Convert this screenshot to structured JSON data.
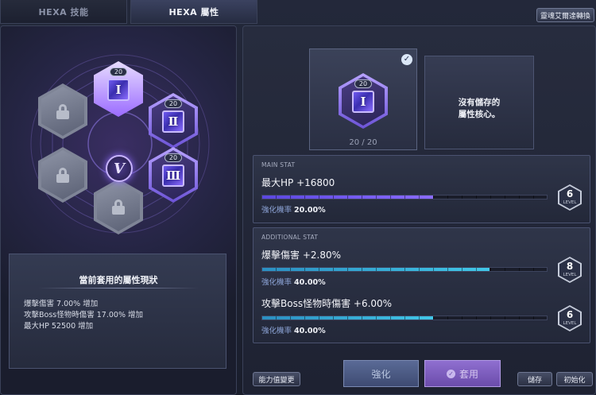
{
  "tabs": [
    {
      "label": "HEXA 技能"
    },
    {
      "label": "HEXA 屬性"
    }
  ],
  "header": {
    "convert_label": "靈魂艾爾達轉換"
  },
  "hexa_grid": {
    "slots": [
      {
        "state": "selected",
        "numeral": "Ⅰ",
        "level": "20"
      },
      {
        "state": "active",
        "numeral": "Ⅱ",
        "level": "20"
      },
      {
        "state": "active",
        "numeral": "Ⅲ",
        "level": "20"
      },
      {
        "state": "locked"
      },
      {
        "state": "locked"
      },
      {
        "state": "locked"
      }
    ],
    "center_emblem": "V"
  },
  "status": {
    "title": "當前套用的屬性現狀",
    "lines": [
      "爆擊傷害 7.00% 增加",
      "攻擊Boss怪物時傷害 17.00% 增加",
      "最大HP 52500 增加"
    ]
  },
  "core_card": {
    "level": "20",
    "numeral": "Ⅰ",
    "count": "20 / 20"
  },
  "empty_card": {
    "text": "沒有儲存的\n屬性核心。"
  },
  "main_stat": {
    "label": "MAIN STAT",
    "name": "最大HP +16800",
    "bar_fraction": 0.6,
    "prob_label": "強化機率",
    "prob_value": "20.00%",
    "level": "6",
    "level_word": "LEVEL"
  },
  "additional_stat": {
    "label": "ADDITIONAL STAT",
    "items": [
      {
        "name": "爆擊傷害 +2.80%",
        "bar_fraction": 0.8,
        "prob_label": "強化機率",
        "prob_value": "40.00%",
        "level": "8",
        "level_word": "LEVEL"
      },
      {
        "name": "攻擊Boss怪物時傷害 +6.00%",
        "bar_fraction": 0.6,
        "prob_label": "強化機率",
        "prob_value": "40.00%",
        "level": "6",
        "level_word": "LEVEL"
      }
    ]
  },
  "buttons": {
    "stat_change": "能力值變更",
    "enhance": "強化",
    "apply": "套用",
    "save": "儲存",
    "init": "初始化"
  },
  "colors": {
    "accent_purple": "#8b6cff",
    "accent_teal": "#41c7e8",
    "panel_bg": "#23283a"
  }
}
